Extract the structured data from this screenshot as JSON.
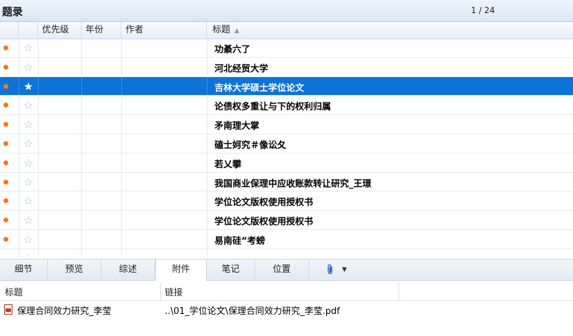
{
  "window": {
    "title": "题录",
    "pager": "1 / 24"
  },
  "columns": {
    "priority": "优先级",
    "year": "年份",
    "author": "作者",
    "title": "标题"
  },
  "rows": [
    {
      "title": "功綦六了",
      "selected": false
    },
    {
      "title": "河北经贸大学",
      "selected": false
    },
    {
      "title": "吉林大学硕士学位论文",
      "selected": true
    },
    {
      "title": "论债权多重让与下的权利归属",
      "selected": false
    },
    {
      "title": "矛南理大掌",
      "selected": false
    },
    {
      "title": "磕士妸究＃像讼夂",
      "selected": false
    },
    {
      "title": "若乂攀",
      "selected": false
    },
    {
      "title": "我国商业保理中应收账款转让研究_王璟",
      "selected": false
    },
    {
      "title": "学位论文版权使用授权书",
      "selected": false
    },
    {
      "title": "学位论文版权使用授权书",
      "selected": false
    },
    {
      "title": "易南硅“考螃",
      "selected": false
    },
    {
      "title": "",
      "selected": false
    }
  ],
  "tabs": [
    "细节",
    "预览",
    "综述",
    "附件",
    "笔记",
    "位置"
  ],
  "active_tab": "附件",
  "icons": {
    "status_dot": "unread-dot-icon",
    "star": "star-icon",
    "clip": "paperclip-icon",
    "pdf": "pdf-file-icon"
  },
  "attachments": {
    "headers": {
      "title": "标题",
      "link": "链接"
    },
    "items": [
      {
        "title": "保理合同效力研究_李莹",
        "link": "..\\01_学位论文\\保理合同效力研究_李莹.pdf"
      }
    ]
  },
  "colors": {
    "selection": "#0e73d6",
    "status_dot": "#f07820",
    "star": "#a8bdd6"
  }
}
